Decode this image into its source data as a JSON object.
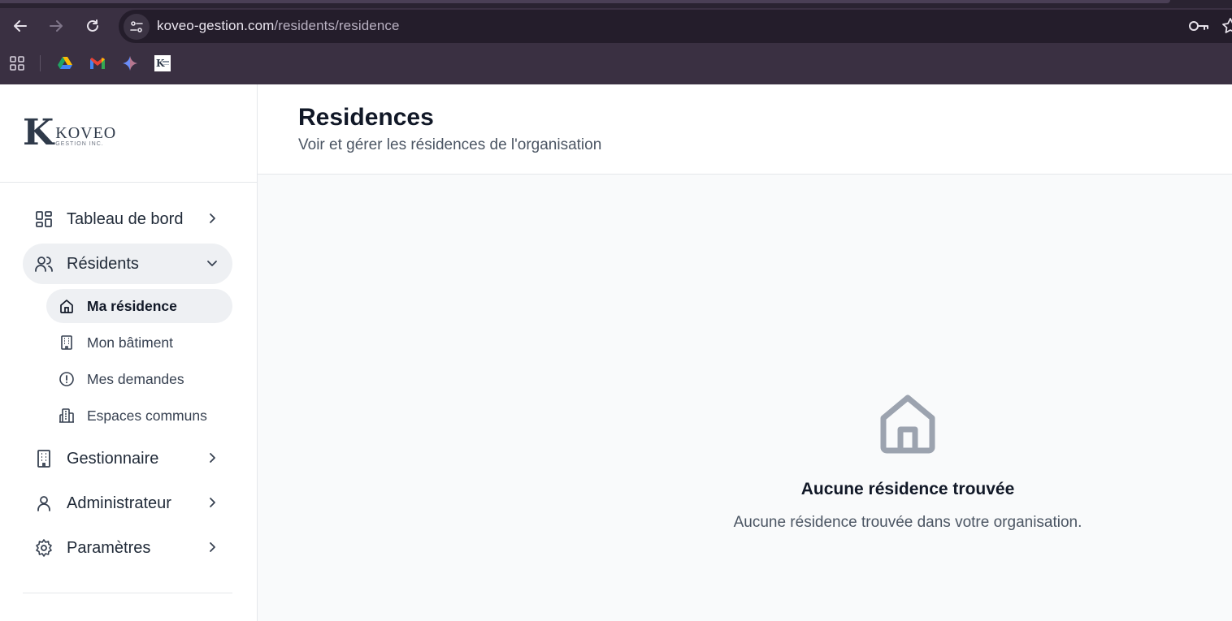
{
  "browser": {
    "url_host": "koveo-gestion.com",
    "url_path": "/residents/residence",
    "icons": [
      "back-icon",
      "forward-icon",
      "reload-icon",
      "site-info-icon",
      "password-key-icon",
      "bookmark-star-icon"
    ],
    "bookmarks": [
      "apps-icon",
      "google-drive-icon",
      "gmail-icon",
      "gemini-icon",
      "koveo-favicon"
    ]
  },
  "sidebar": {
    "logo": {
      "initial": "K",
      "name": "KOVEO",
      "sub": "GESTION INC."
    },
    "items": [
      {
        "label": "Tableau de bord",
        "icon": "dashboard-icon",
        "expanded": false
      },
      {
        "label": "Résidents",
        "icon": "users-icon",
        "expanded": true,
        "children": [
          {
            "label": "Ma résidence",
            "icon": "home-icon",
            "active": true
          },
          {
            "label": "Mon bâtiment",
            "icon": "building-icon",
            "active": false
          },
          {
            "label": "Mes demandes",
            "icon": "alert-circle-icon",
            "active": false
          },
          {
            "label": "Espaces communs",
            "icon": "building-2-icon",
            "active": false
          }
        ]
      },
      {
        "label": "Gestionnaire",
        "icon": "building-icon",
        "expanded": false
      },
      {
        "label": "Administrateur",
        "icon": "user-icon",
        "expanded": false
      },
      {
        "label": "Paramètres",
        "icon": "settings-icon",
        "expanded": false
      }
    ]
  },
  "header": {
    "title": "Residences",
    "subtitle": "Voir et gérer les résidences de l'organisation"
  },
  "empty_state": {
    "icon": "home-icon",
    "title": "Aucune résidence trouvée",
    "description": "Aucune résidence trouvée dans votre organisation."
  },
  "colors": {
    "chrome_bg": "#3a3042",
    "omnibox_bg": "#241d2b",
    "active_nav_bg": "#eef0f3",
    "main_bg": "#f9fafb",
    "empty_icon": "#9ca3af"
  }
}
